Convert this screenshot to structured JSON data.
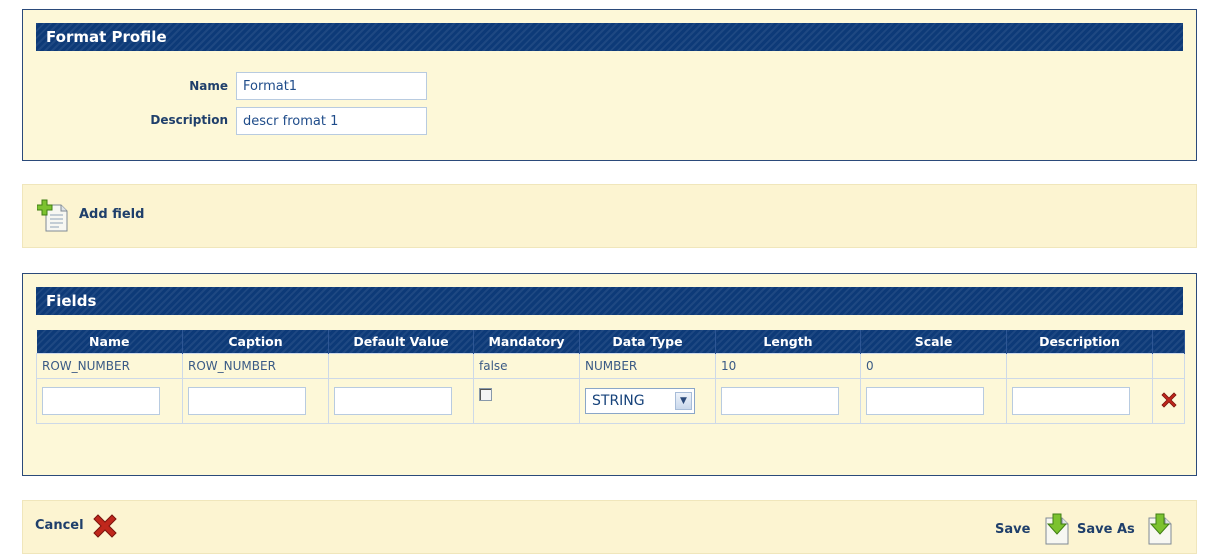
{
  "profile": {
    "title": "Format Profile",
    "name_label": "Name",
    "name_value": "Format1",
    "description_label": "Description",
    "description_value": "descr fromat 1"
  },
  "toolbar": {
    "add_field_label": "Add field"
  },
  "fields": {
    "title": "Fields",
    "columns": [
      "Name",
      "Caption",
      "Default Value",
      "Mandatory",
      "Data Type",
      "Length",
      "Scale",
      "Description"
    ],
    "rows": [
      {
        "name": "ROW_NUMBER",
        "caption": "ROW_NUMBER",
        "default_value": "",
        "mandatory": "false",
        "data_type": "NUMBER",
        "length": "10",
        "scale": "0",
        "description": ""
      }
    ],
    "new_row": {
      "data_type_selected": "STRING",
      "mandatory_checked": false
    }
  },
  "footer": {
    "cancel_label": "Cancel",
    "save_label": "Save",
    "save_as_label": "Save As"
  },
  "colors": {
    "header_navy": "#0d3a78",
    "panel_bg": "#fdf8d8",
    "band_bg": "#fcf4d1",
    "text_blue": "#1f3f6b",
    "delete_red": "#c0271c"
  }
}
